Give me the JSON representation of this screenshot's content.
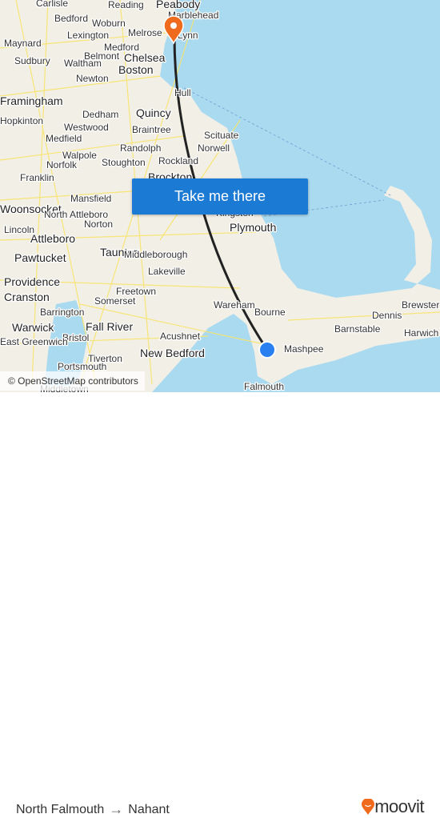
{
  "map": {
    "labels": [
      "Carlisle",
      "Reading",
      "Peabody",
      "Marblehead",
      "Bedford",
      "Woburn",
      "Maynard",
      "Lexington",
      "Melrose",
      "Lynn",
      "Medford",
      "Sudbury",
      "Belmont",
      "Chelsea",
      "Waltham",
      "Boston",
      "Newton",
      "Hull",
      "Framingham",
      "Dedham",
      "Quincy",
      "Hopkinton",
      "Braintree",
      "Westwood",
      "Scituate",
      "Medfield",
      "Randolph",
      "Norwell",
      "Walpole",
      "Norfolk",
      "Stoughton",
      "Rockland",
      "Franklin",
      "Brockton",
      "Mansfield",
      "Kingston",
      "Woonsocket",
      "North Attleboro",
      "Norton",
      "Plymouth",
      "Lincoln",
      "Attleboro",
      "Taunton",
      "Middleborough",
      "Pawtucket",
      "Lakeville",
      "Providence",
      "Freetown",
      "Cranston",
      "Somerset",
      "Barrington",
      "Wareham",
      "Bourne",
      "Brewster",
      "Warwick",
      "Fall River",
      "Dennis",
      "Barnstable",
      "Bristol",
      "Acushnet",
      "East Greenwich",
      "Mashpee",
      "Harwich",
      "New Bedford",
      "Tiverton",
      "Portsmouth",
      "Falmouth",
      "Middletown"
    ],
    "colors": {
      "water": "#aadaf0",
      "land": "#f2efe6",
      "roads": "#f7e36a",
      "route": "#222222",
      "origin": "#2a80f0",
      "destination": "#f06a1d"
    }
  },
  "cta": {
    "label": "Take me there"
  },
  "attribution": "© OpenStreetMap contributors",
  "footer": {
    "origin": "North Falmouth",
    "arrow": "→",
    "destination": "Nahant",
    "brand": "moovit",
    "brand_color": "#f06a1d"
  },
  "icons": {
    "origin": "origin-dot-icon",
    "destination": "destination-pin-icon",
    "arrow": "arrow-right-icon",
    "logo": "moovit-logo-icon"
  }
}
